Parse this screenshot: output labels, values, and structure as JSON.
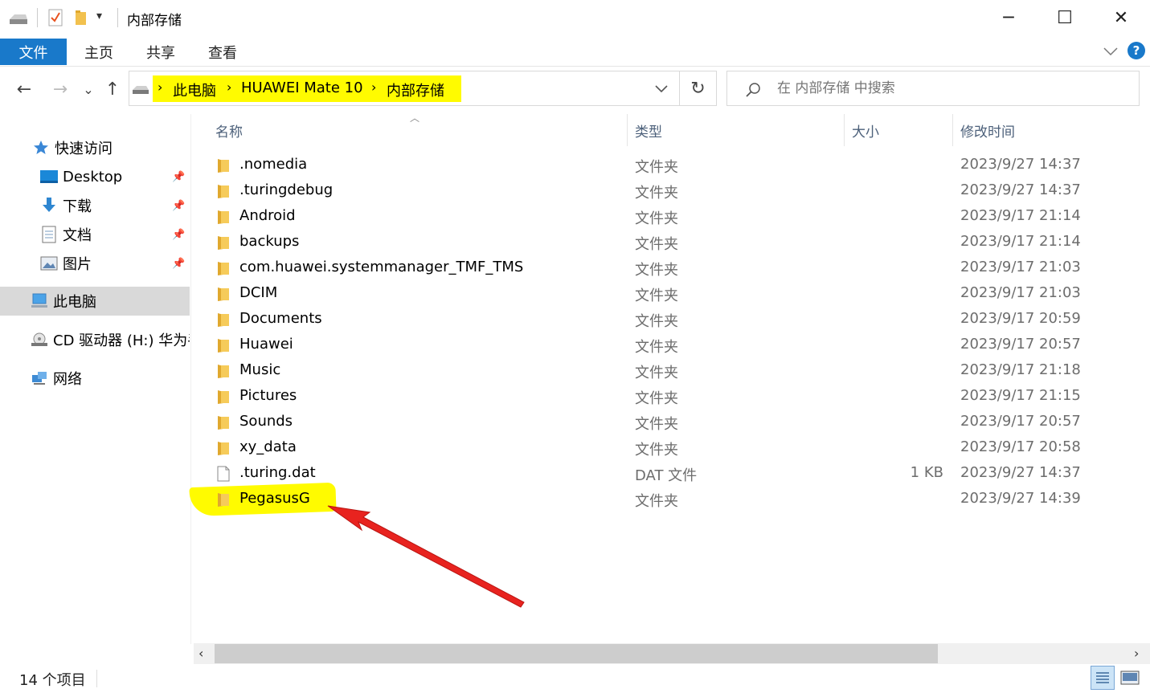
{
  "window": {
    "title": "内部存储",
    "controls": {
      "minimize": "─",
      "maximize": "☐",
      "close": "✕"
    }
  },
  "ribbon": {
    "tabs": [
      "文件",
      "主页",
      "共享",
      "查看"
    ],
    "expand_icon": "chevron-down",
    "help_icon": "?"
  },
  "nav": {
    "back": "←",
    "forward": "→",
    "recent": "⌄",
    "up": "↑"
  },
  "address": {
    "crumbs": [
      "此电脑",
      "HUAWEI Mate 10",
      "内部存储"
    ],
    "highlight_color": "#fffb00"
  },
  "search": {
    "placeholder": "在 内部存储 中搜索"
  },
  "sidebar": {
    "items": [
      {
        "label": "快速访问",
        "icon": "star-icon"
      },
      {
        "label": "Desktop",
        "icon": "desktop-icon",
        "pinned": true
      },
      {
        "label": "下载",
        "icon": "download-icon",
        "pinned": true
      },
      {
        "label": "文档",
        "icon": "document-icon",
        "pinned": true
      },
      {
        "label": "图片",
        "icon": "pictures-icon",
        "pinned": true
      },
      {
        "label": "此电脑",
        "icon": "computer-icon",
        "selected": true
      },
      {
        "label": "CD 驱动器 (H:) 华为手",
        "icon": "cd-drive-icon"
      },
      {
        "label": "网络",
        "icon": "network-icon"
      }
    ]
  },
  "columns": {
    "name": "名称",
    "type": "类型",
    "size": "大小",
    "modified": "修改时间"
  },
  "files": [
    {
      "name": ".nomedia",
      "type": "文件夹",
      "size": "",
      "modified": "2023/9/27 14:37",
      "kind": "folder"
    },
    {
      "name": ".turingdebug",
      "type": "文件夹",
      "size": "",
      "modified": "2023/9/27 14:37",
      "kind": "folder"
    },
    {
      "name": "Android",
      "type": "文件夹",
      "size": "",
      "modified": "2023/9/17 21:14",
      "kind": "folder"
    },
    {
      "name": "backups",
      "type": "文件夹",
      "size": "",
      "modified": "2023/9/17 21:14",
      "kind": "folder"
    },
    {
      "name": "com.huawei.systemmanager_TMF_TMS",
      "type": "文件夹",
      "size": "",
      "modified": "2023/9/17 21:03",
      "kind": "folder"
    },
    {
      "name": "DCIM",
      "type": "文件夹",
      "size": "",
      "modified": "2023/9/17 21:03",
      "kind": "folder"
    },
    {
      "name": "Documents",
      "type": "文件夹",
      "size": "",
      "modified": "2023/9/17 20:59",
      "kind": "folder"
    },
    {
      "name": "Huawei",
      "type": "文件夹",
      "size": "",
      "modified": "2023/9/17 20:57",
      "kind": "folder"
    },
    {
      "name": "Music",
      "type": "文件夹",
      "size": "",
      "modified": "2023/9/17 21:18",
      "kind": "folder"
    },
    {
      "name": "Pictures",
      "type": "文件夹",
      "size": "",
      "modified": "2023/9/17 21:15",
      "kind": "folder"
    },
    {
      "name": "Sounds",
      "type": "文件夹",
      "size": "",
      "modified": "2023/9/17 20:57",
      "kind": "folder"
    },
    {
      "name": "xy_data",
      "type": "文件夹",
      "size": "",
      "modified": "2023/9/17 20:58",
      "kind": "folder"
    },
    {
      "name": ".turing.dat",
      "type": "DAT 文件",
      "size": "1 KB",
      "modified": "2023/9/27 14:37",
      "kind": "file"
    },
    {
      "name": "PegasusG",
      "type": "文件夹",
      "size": "",
      "modified": "2023/9/27 14:39",
      "kind": "folder",
      "highlighted": true
    }
  ],
  "annotation": {
    "arrow_color": "#e8231f",
    "highlight_color": "#fffb00"
  },
  "status": {
    "item_count": "14 个项目"
  },
  "colors": {
    "accent": "#1979ca",
    "folder": "#f2c14e",
    "selected_nav": "#d9d9d9"
  }
}
